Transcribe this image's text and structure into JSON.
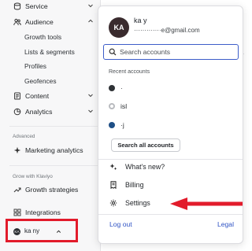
{
  "sidebar": {
    "items": {
      "service": "Service",
      "audience": "Audience",
      "growth_tools": "Growth tools",
      "lists_segments": "Lists & segments",
      "profiles": "Profiles",
      "geofences": "Geofences",
      "content": "Content",
      "analytics": "Analytics",
      "marketing_analytics": "Marketing analytics",
      "growth_strategies": "Growth strategies",
      "integrations": "Integrations"
    },
    "sections": {
      "advanced": "Advanced",
      "grow_with_klaviyo": "Grow with Klaviyo"
    },
    "account_button": {
      "initials": "KA",
      "name": "ka     ny"
    }
  },
  "popover": {
    "avatar_initials": "KA",
    "account_name": "ka     y",
    "email": "·············e@gmail.com",
    "search": {
      "placeholder": "Search accounts",
      "value": ""
    },
    "recent_label": "Recent accounts",
    "recent_accounts": [
      {
        "name": "·",
        "color": "#2f3236"
      },
      {
        "name": "isl",
        "color": "#c7c9cc"
      },
      {
        "name": "·j",
        "color": "#1f4f86"
      }
    ],
    "search_all_label": "Search all accounts",
    "menu": {
      "whats_new": "What's new?",
      "billing": "Billing",
      "settings": "Settings"
    },
    "footer": {
      "logout": "Log out",
      "legal": "Legal"
    }
  },
  "colors": {
    "accent_blue": "#2e52c4",
    "annotation_red": "#e21b2b",
    "sidebar_bg": "#f7f7f8"
  }
}
